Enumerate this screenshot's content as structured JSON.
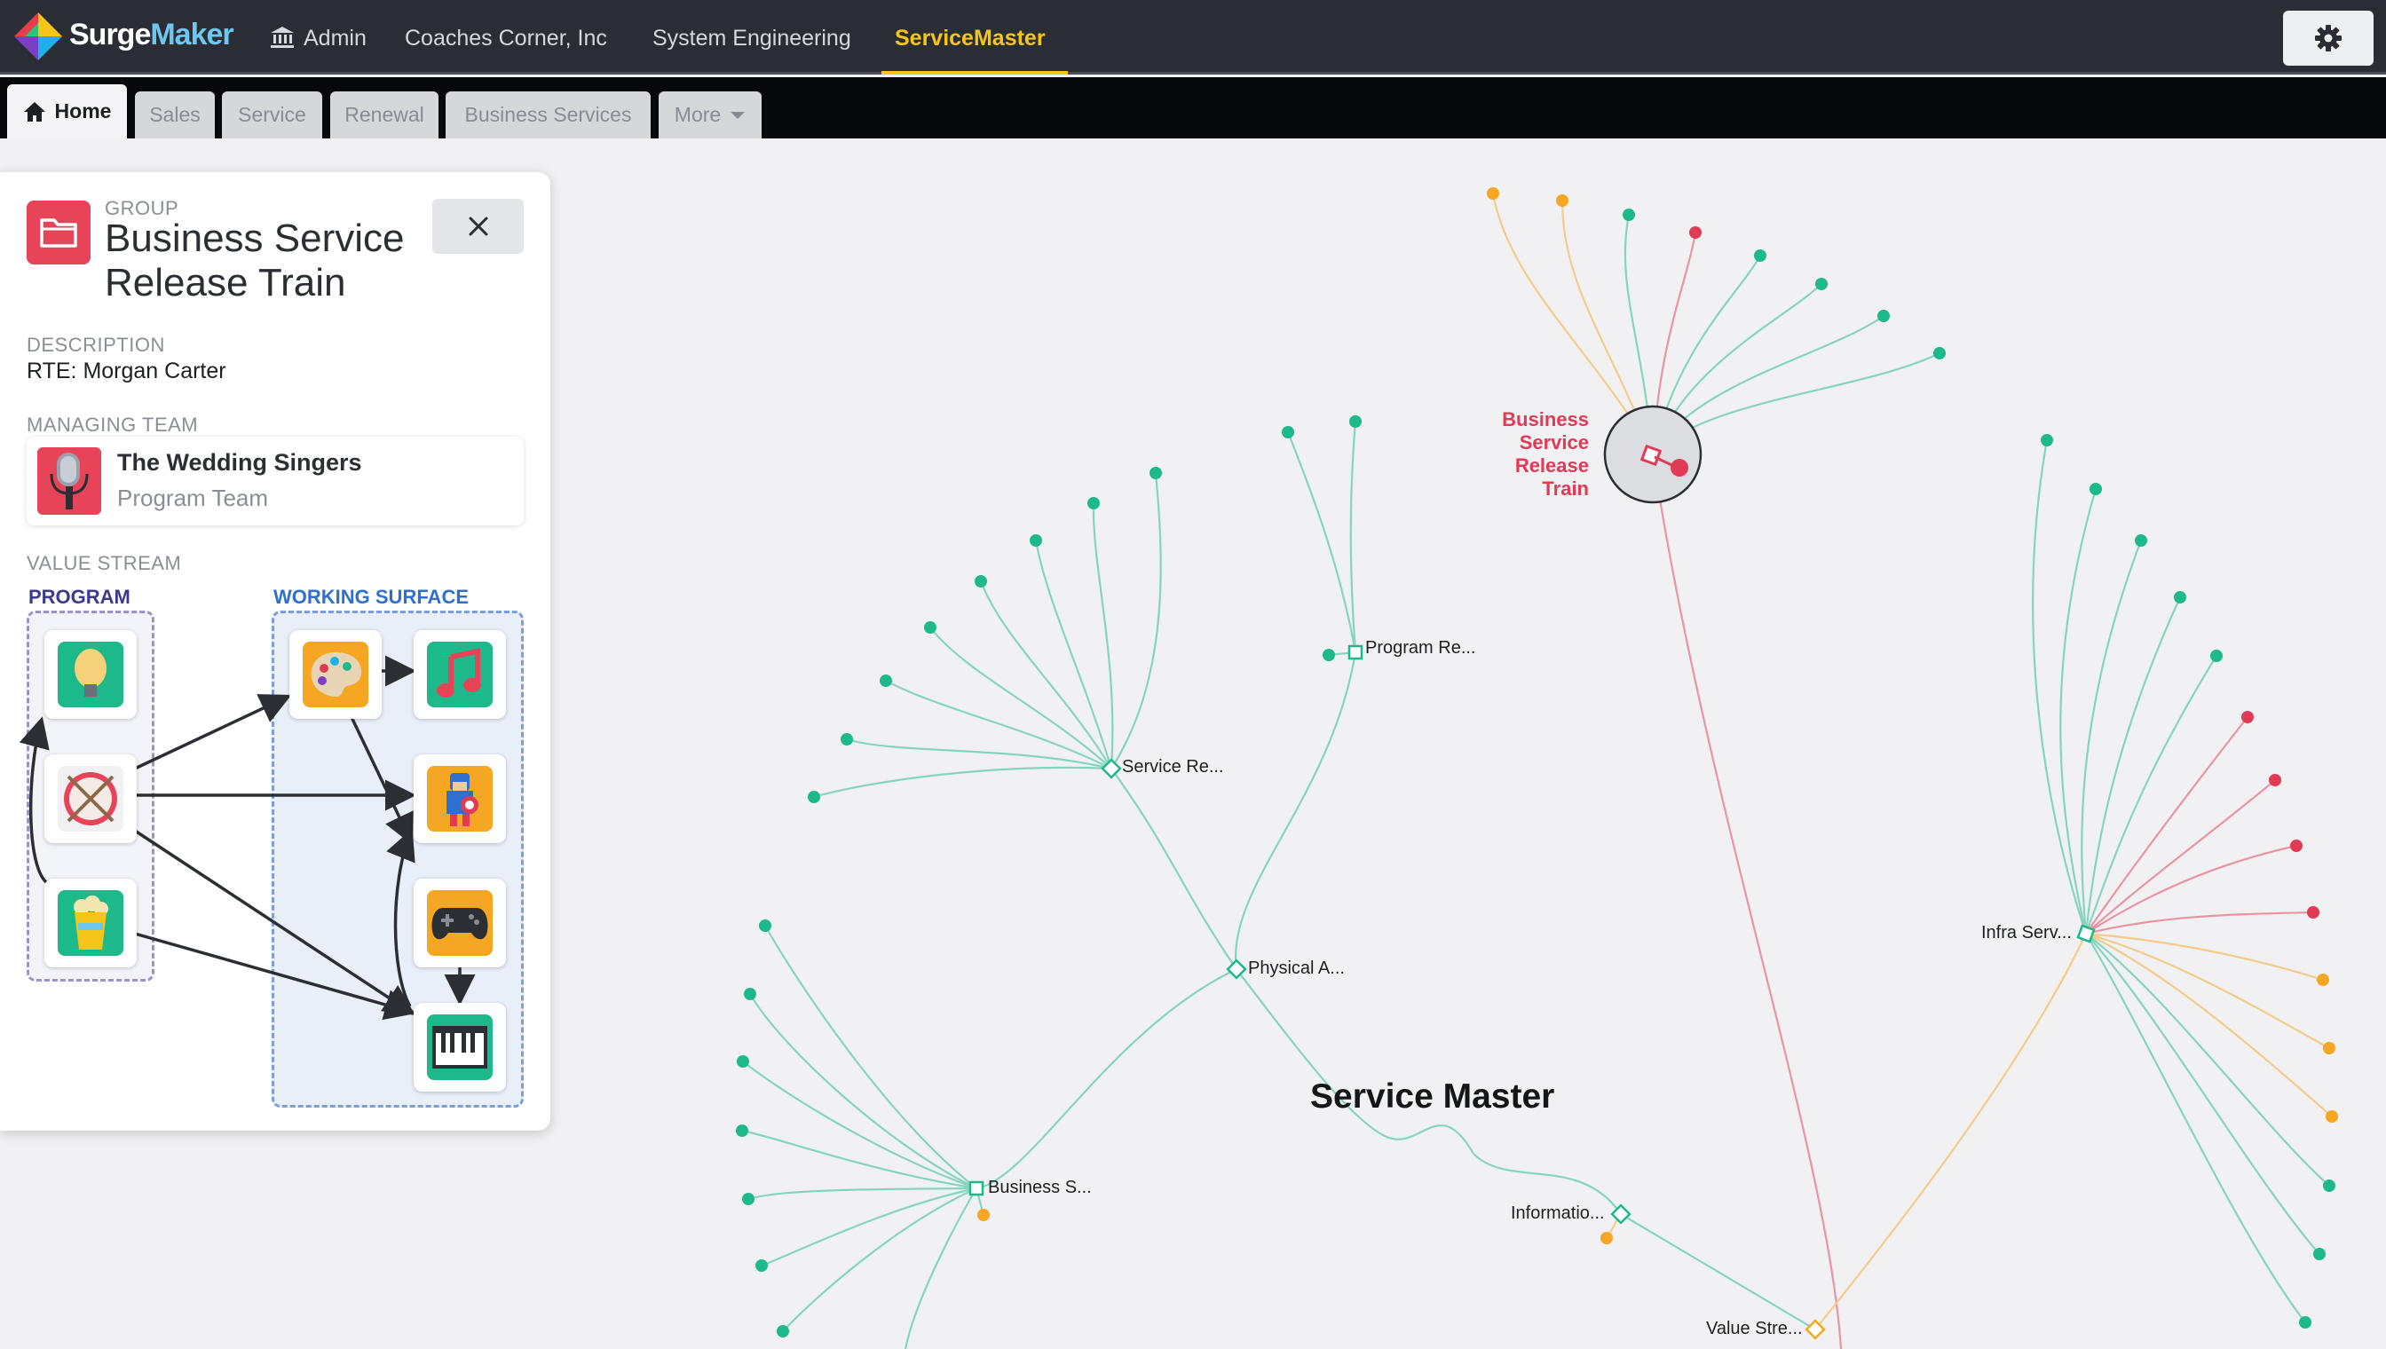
{
  "app": {
    "brand_a": "Surge",
    "brand_b": "Maker"
  },
  "nav": {
    "items": [
      {
        "label": "Admin"
      },
      {
        "label": "Coaches Corner, Inc"
      },
      {
        "label": "System Engineering"
      },
      {
        "label": "ServiceMaster",
        "active": true
      }
    ]
  },
  "tabs": [
    {
      "label": "Home",
      "active": true
    },
    {
      "label": "Sales"
    },
    {
      "label": "Service"
    },
    {
      "label": "Renewal"
    },
    {
      "label": "Business Services"
    },
    {
      "label": "More"
    }
  ],
  "panel": {
    "type_label": "GROUP",
    "title": "Business Service Release Train",
    "description_label": "DESCRIPTION",
    "description": "RTE: Morgan Carter",
    "managing_team_label": "MANAGING TEAM",
    "team_name": "The Wedding Singers",
    "team_type": "Program Team",
    "value_stream_label": "VALUE STREAM",
    "program_label": "PROGRAM",
    "working_surface_label": "WORKING SURFACE"
  },
  "graph": {
    "root_label": "Service Master",
    "nodes": [
      {
        "label": "Program Re..."
      },
      {
        "label": "Service Re..."
      },
      {
        "label": "Physical A..."
      },
      {
        "label": "Business S..."
      },
      {
        "label": "Informatio..."
      },
      {
        "label": "Value Stre..."
      },
      {
        "label": "Infra Serv..."
      }
    ],
    "selected_label": "Business Service Release Train"
  },
  "colors": {
    "teal": "#1db98a",
    "red": "#e03a54",
    "orange": "#f5a623",
    "accent": "#f5c518"
  }
}
